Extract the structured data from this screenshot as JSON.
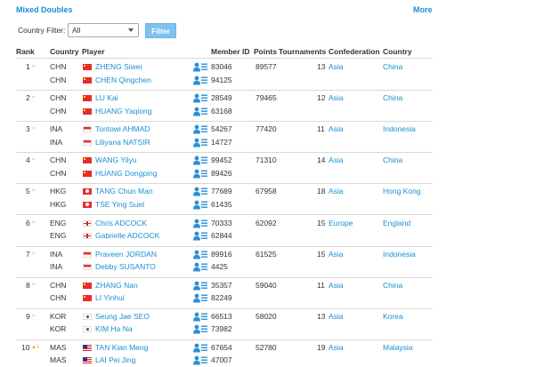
{
  "header": {
    "title": "Mixed Doubles",
    "more": "More"
  },
  "filter": {
    "label": "Country Filter:",
    "selected": "All",
    "button": "Filter"
  },
  "columns": [
    "Rank",
    "Country",
    "Player",
    "Member ID",
    "Points",
    "Tournaments",
    "Confederation",
    "Country"
  ],
  "colors": {
    "link": "#1a8fd0",
    "button": "#7fc3ed"
  },
  "rows": [
    {
      "rank": "1",
      "trend": "=",
      "points": "89577",
      "tournaments": "13",
      "confederation": "Asia",
      "country": "China",
      "players": [
        {
          "code": "CHN",
          "flag": "chn",
          "name": "ZHENG Siwei",
          "id": "83046"
        },
        {
          "code": "CHN",
          "flag": "chn",
          "name": "CHEN Qingchen",
          "id": "94125"
        }
      ]
    },
    {
      "rank": "2",
      "trend": "=",
      "points": "79465",
      "tournaments": "12",
      "confederation": "Asia",
      "country": "China",
      "players": [
        {
          "code": "CHN",
          "flag": "chn",
          "name": "LU Kai",
          "id": "28549"
        },
        {
          "code": "CHN",
          "flag": "chn",
          "name": "HUANG Yaqiong",
          "id": "63168"
        }
      ]
    },
    {
      "rank": "3",
      "trend": "=",
      "points": "77420",
      "tournaments": "11",
      "confederation": "Asia",
      "country": "Indonesia",
      "players": [
        {
          "code": "INA",
          "flag": "ina",
          "name": "Tontowi AHMAD",
          "id": "54267"
        },
        {
          "code": "INA",
          "flag": "ina",
          "name": "Liliyana NATSIR",
          "id": "14727"
        }
      ]
    },
    {
      "rank": "4",
      "trend": "=",
      "points": "71310",
      "tournaments": "14",
      "confederation": "Asia",
      "country": "China",
      "players": [
        {
          "code": "CHN",
          "flag": "chn",
          "name": "WANG Yilyu",
          "id": "99452"
        },
        {
          "code": "CHN",
          "flag": "chn",
          "name": "HUANG Dongping",
          "id": "89426"
        }
      ]
    },
    {
      "rank": "5",
      "trend": "=",
      "points": "67958",
      "tournaments": "18",
      "confederation": "Asia",
      "country": "Hong Kong",
      "players": [
        {
          "code": "HKG",
          "flag": "hkg",
          "name": "TANG Chun Man",
          "id": "77689"
        },
        {
          "code": "HKG",
          "flag": "hkg",
          "name": "TSE Ying Suet",
          "id": "61435"
        }
      ]
    },
    {
      "rank": "6",
      "trend": "=",
      "points": "62092",
      "tournaments": "15",
      "confederation": "Europe",
      "country": "England",
      "players": [
        {
          "code": "ENG",
          "flag": "eng",
          "name": "Chris ADCOCK",
          "id": "70333"
        },
        {
          "code": "ENG",
          "flag": "eng",
          "name": "Gabrielle ADCOCK",
          "id": "62844"
        }
      ]
    },
    {
      "rank": "7",
      "trend": "=",
      "points": "61525",
      "tournaments": "15",
      "confederation": "Asia",
      "country": "Indonesia",
      "players": [
        {
          "code": "INA",
          "flag": "ina",
          "name": "Praveen JORDAN",
          "id": "89916"
        },
        {
          "code": "INA",
          "flag": "ina",
          "name": "Debby SUSANTO",
          "id": "4425"
        }
      ]
    },
    {
      "rank": "8",
      "trend": "=",
      "points": "59040",
      "tournaments": "11",
      "confederation": "Asia",
      "country": "China",
      "players": [
        {
          "code": "CHN",
          "flag": "chn",
          "name": "ZHANG Nan",
          "id": "35357"
        },
        {
          "code": "CHN",
          "flag": "chn",
          "name": "LI Yinhui",
          "id": "82249"
        }
      ]
    },
    {
      "rank": "9",
      "trend": "=",
      "points": "58020",
      "tournaments": "13",
      "confederation": "Asia",
      "country": "Korea",
      "players": [
        {
          "code": "KOR",
          "flag": "kor",
          "name": "Seung Jae SEO",
          "id": "66513"
        },
        {
          "code": "KOR",
          "flag": "kor",
          "name": "KIM Ha Na",
          "id": "73982"
        }
      ]
    },
    {
      "rank": "10",
      "trend": "▲1",
      "trend_up": true,
      "points": "52780",
      "tournaments": "19",
      "confederation": "Asia",
      "country": "Malaysia",
      "players": [
        {
          "code": "MAS",
          "flag": "mas",
          "name": "TAN Kian Meng",
          "id": "67654"
        },
        {
          "code": "MAS",
          "flag": "mas",
          "name": "LAI Pei Jing",
          "id": "47007"
        }
      ]
    }
  ]
}
